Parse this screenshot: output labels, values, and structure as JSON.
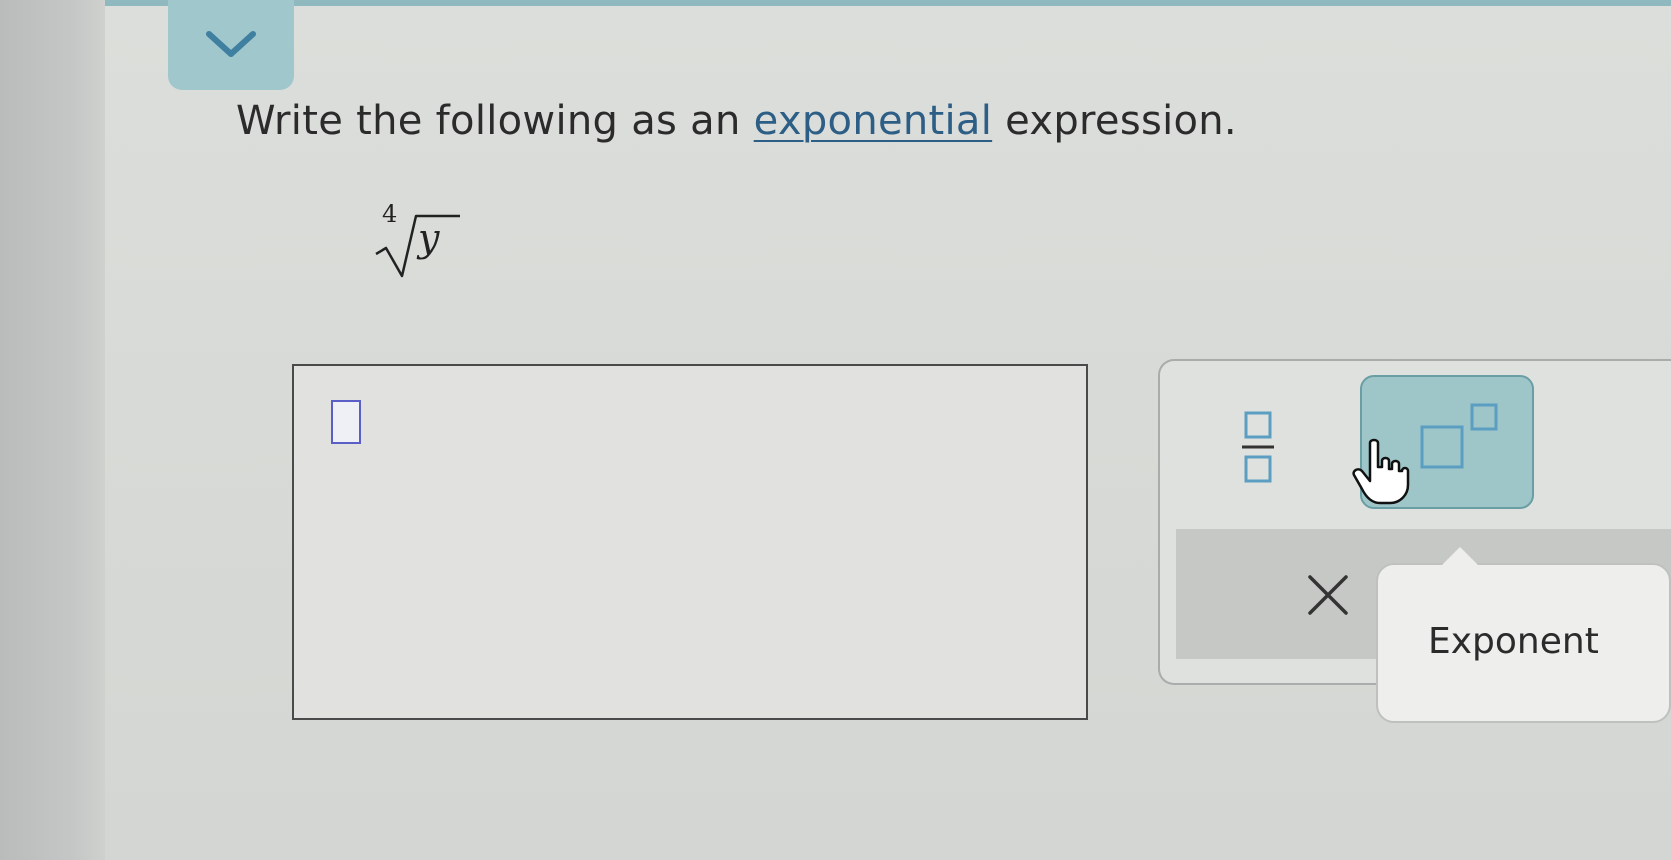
{
  "question": {
    "prefix": "Write the following as an",
    "link_text": "exponential",
    "suffix": "expression."
  },
  "problem": {
    "radical_index": "4",
    "radicand": "y"
  },
  "toolbar": {
    "tooltip_text": "Exponent",
    "icons": {
      "collapse": "chevron-down-icon",
      "fraction": "fraction-template-icon",
      "exponent": "exponent-template-icon",
      "clear": "close-icon",
      "pointer": "hand-pointer-icon"
    }
  },
  "colors": {
    "accent": "#9fc7cc",
    "link": "#2d5e86",
    "input_cursor": "#5a5fc7"
  }
}
